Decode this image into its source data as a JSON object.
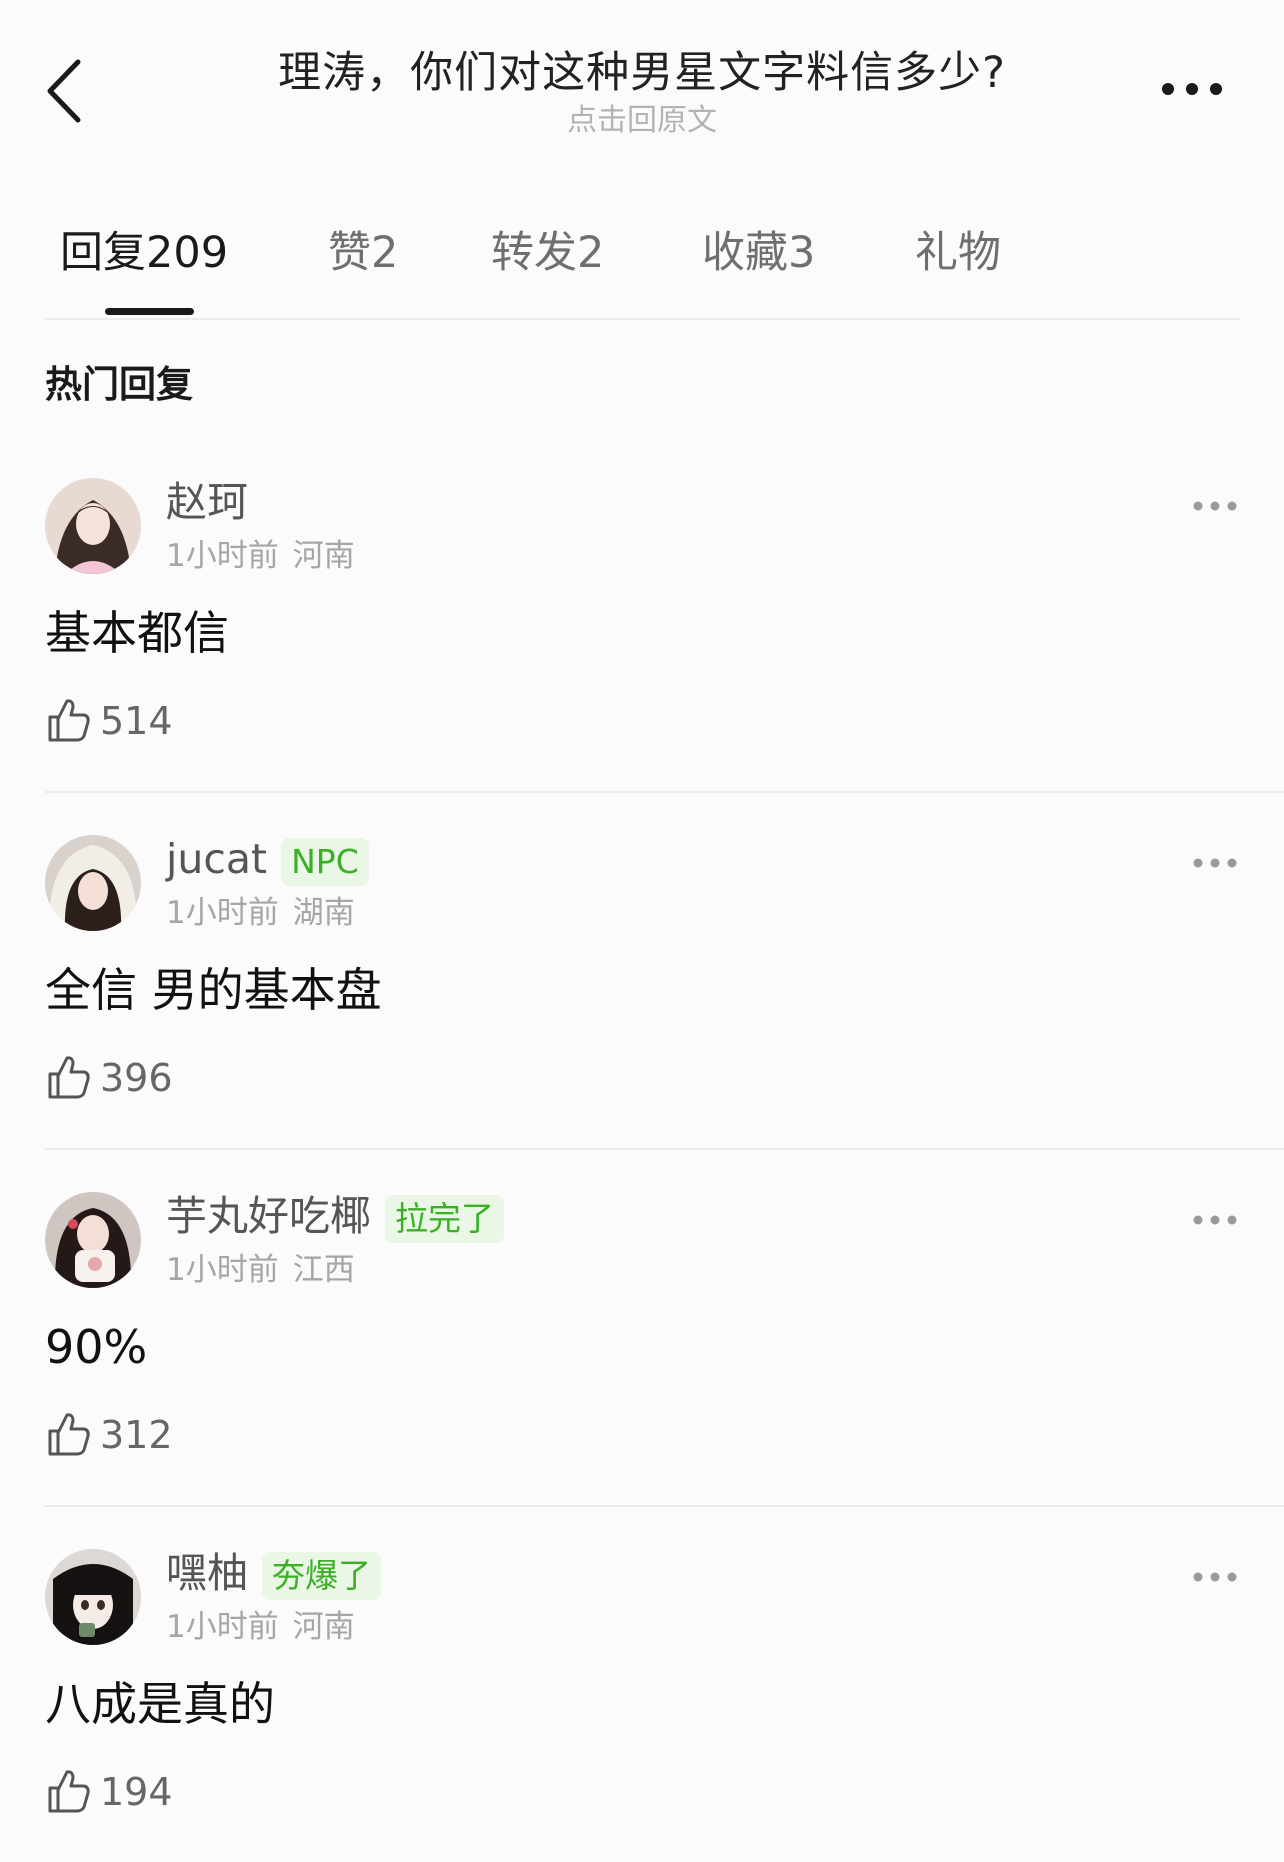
{
  "header": {
    "title": "理涛，你们对这种男星文字料信多少?",
    "subtitle": "点击回原文"
  },
  "tabs": [
    {
      "label": "回复209",
      "active": true
    },
    {
      "label": "赞2",
      "active": false
    },
    {
      "label": "转发2",
      "active": false
    },
    {
      "label": "收藏3",
      "active": false
    },
    {
      "label": "礼物",
      "active": false
    }
  ],
  "section_title": "热门回复",
  "comments": [
    {
      "username": "赵珂",
      "badge": "",
      "time": "1小时前",
      "location": "河南",
      "text": "基本都信",
      "likes": "514"
    },
    {
      "username": "jucat",
      "badge": "NPC",
      "time": "1小时前",
      "location": "湖南",
      "text": "全信 男的基本盘",
      "likes": "396"
    },
    {
      "username": "芋丸好吃椰",
      "badge": "拉完了",
      "time": "1小时前",
      "location": "江西",
      "text": "90%",
      "likes": "312"
    },
    {
      "username": "嘿柚",
      "badge": "夯爆了",
      "time": "1小时前",
      "location": "河南",
      "text": "八成是真的",
      "likes": "194"
    }
  ],
  "colors": {
    "badge_text": "#3bb027",
    "badge_bg": "#eaf6e6",
    "background": "#fbfbfb"
  },
  "icons": [
    "back-chevron-icon",
    "more-horizontal-icon",
    "thumbs-up-icon"
  ]
}
